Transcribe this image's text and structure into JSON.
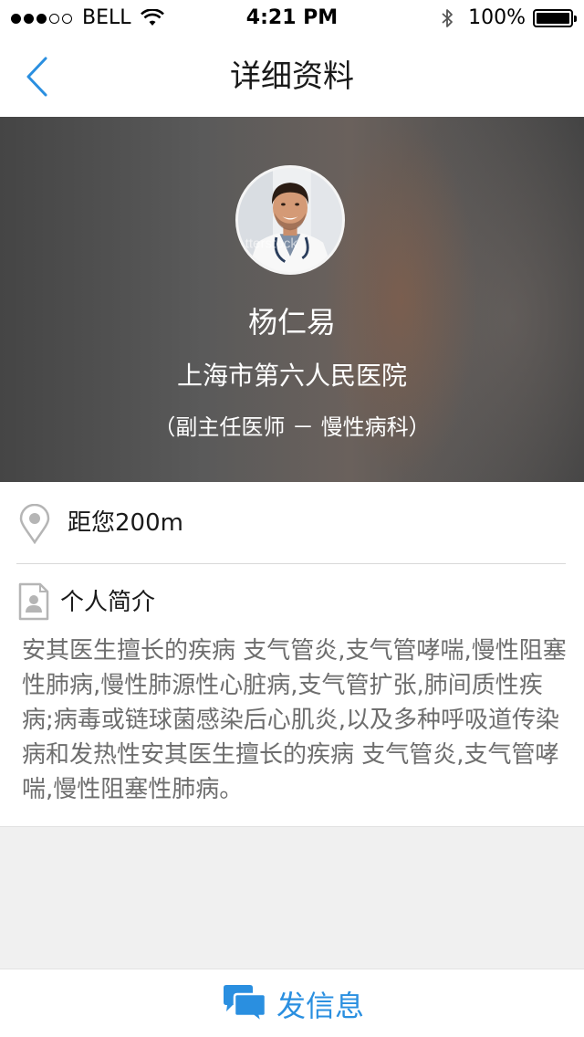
{
  "status_bar": {
    "carrier": "BELL",
    "time": "4:21 PM",
    "battery": "100%",
    "battery_level": 1.0,
    "signal_bars_filled": 3,
    "signal_bars_total": 5
  },
  "nav": {
    "title": "详细资料",
    "back_icon": "chevron-left-icon"
  },
  "profile": {
    "name": "杨仁易",
    "hospital": "上海市第六人民医院",
    "title": "（副主任医师 － 慢性病科）",
    "avatar_watermark": "tterstock"
  },
  "distance": {
    "icon": "location-pin-icon",
    "text": "距您200m"
  },
  "intro": {
    "icon": "profile-card-icon",
    "title": "个人简介",
    "body": "安其医生擅长的疾病 支气管炎,支气管哮喘,慢性阻塞性肺病,慢性肺源性心脏病,支气管扩张,肺间质性疾病;病毒或链球菌感染后心肌炎,以及多种呼吸道传染病和发热性安其医生擅长的疾病 支气管炎,支气管哮喘,慢性阻塞性肺病。"
  },
  "bottom": {
    "message_label": "发信息",
    "icon": "chat-bubbles-icon"
  },
  "colors": {
    "accent": "#2a8fe0",
    "intro_text": "#6e6e6e",
    "divider": "#d8d8d8",
    "empty_area": "#f0f0f0"
  }
}
